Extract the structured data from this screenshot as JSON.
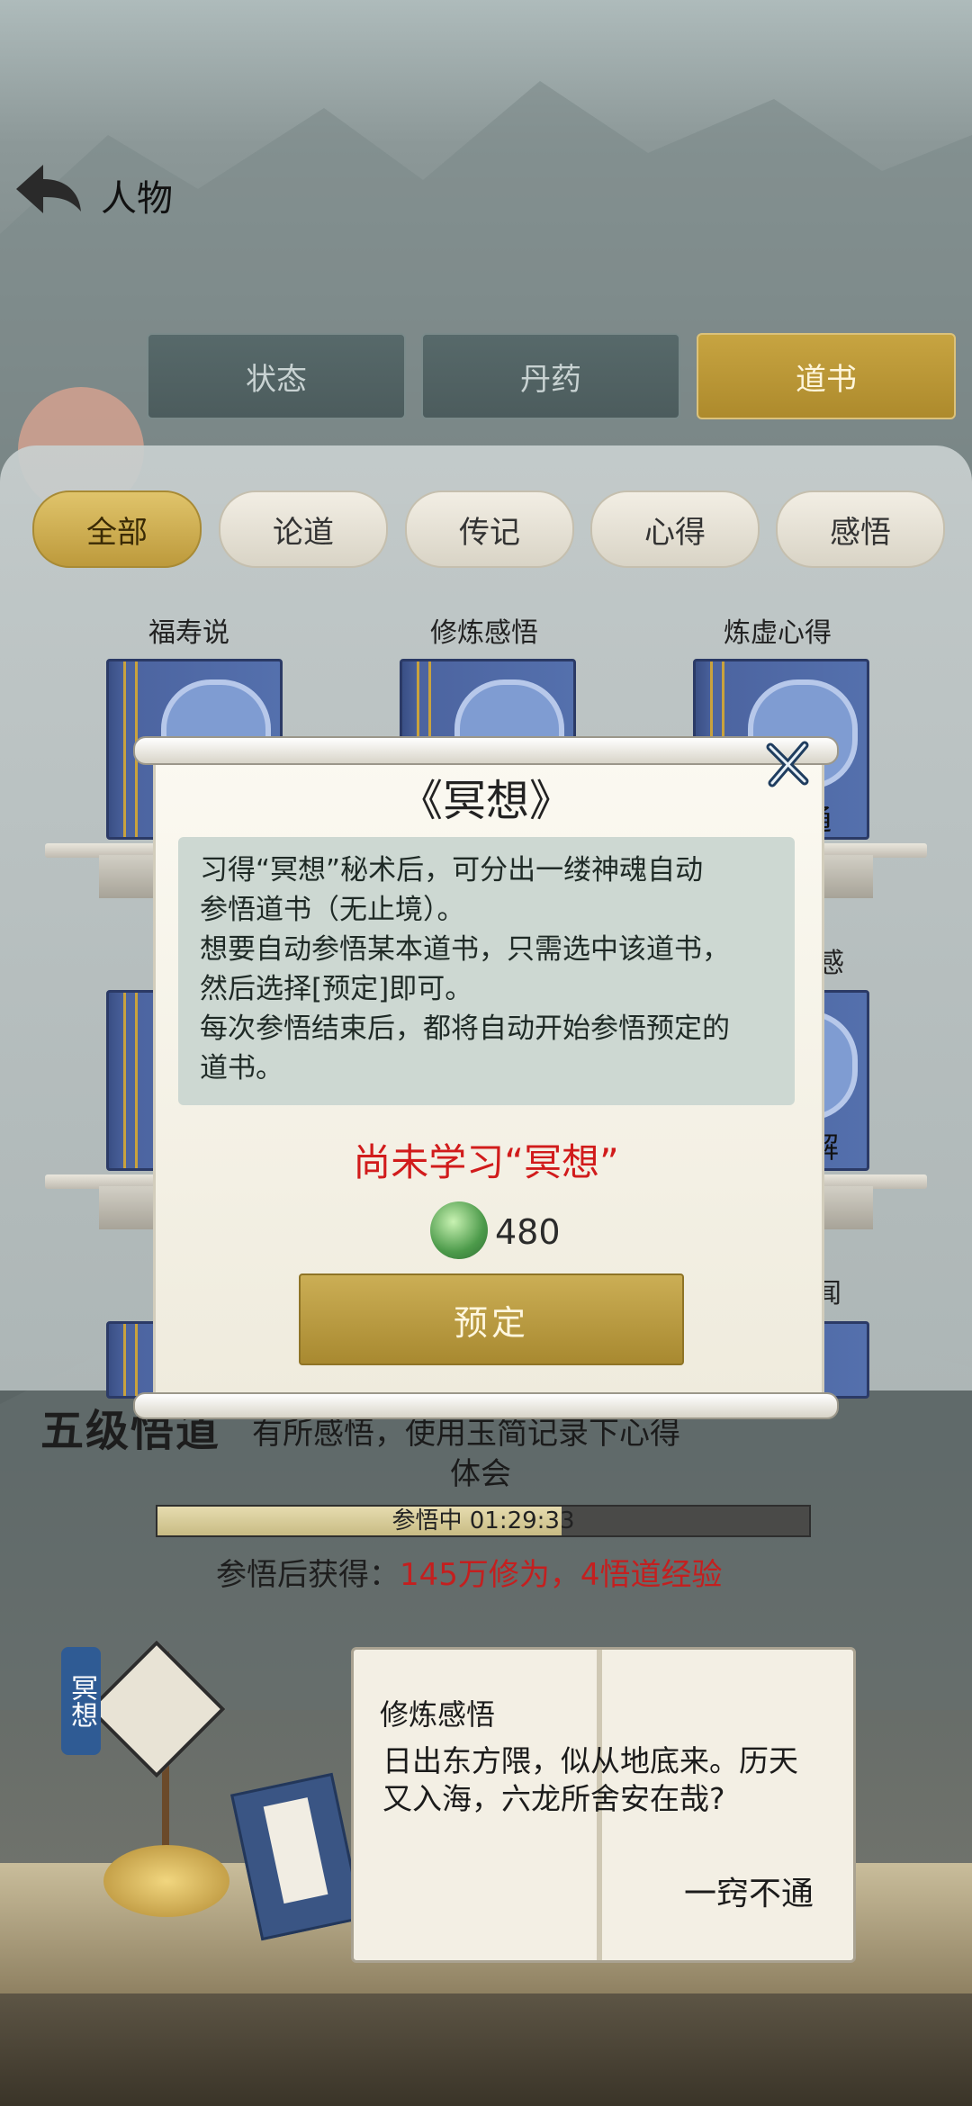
{
  "header": {
    "title": "人物"
  },
  "main_tabs": [
    {
      "label": "状态"
    },
    {
      "label": "丹药"
    },
    {
      "label": "道书",
      "active": true
    }
  ],
  "sub_tabs": [
    {
      "label": "全部",
      "active": true
    },
    {
      "label": "论道"
    },
    {
      "label": "传记"
    },
    {
      "label": "心得"
    },
    {
      "label": "感悟"
    }
  ],
  "books": [
    {
      "title": "福寿说"
    },
    {
      "title": "修炼感悟"
    },
    {
      "title": "炼虚心得"
    }
  ],
  "partial_labels": {
    "right_top_status": "通",
    "right_mid_title": "感",
    "right_mid_status": "解",
    "right_bottom_title": "闻"
  },
  "progress": {
    "rank": "五级悟道",
    "hint_line1": "有所感悟，使用玉简记录下心得",
    "hint_line2": "体会",
    "status": "参悟中 01:29:33",
    "fraction": 0.62,
    "reward_label": "参悟后获得：",
    "reward_value": "145万修为，4悟道经验"
  },
  "scene": {
    "meditate_tag": "冥想",
    "open_book": {
      "heading": "修炼感悟",
      "line1": "日出东方隈，似从地底来。历天",
      "line2": "又入海，六龙所舍安在哉?",
      "status": "一窍不通"
    }
  },
  "modal": {
    "title": "《冥想》",
    "desc_lines": [
      "习得“冥想”秘术后，可分出一缕神魂自动",
      "参悟道书（无止境）。",
      "想要自动参悟某本道书，只需选中该道书，",
      "然后选择[预定]即可。",
      "每次参悟结束后，都将自动开始参悟预定的",
      "道书。"
    ],
    "warning": "尚未学习“冥想”",
    "cost_value": "480",
    "button_label": "预定"
  },
  "colors": {
    "accent_gold": "#bd9a3c",
    "warning_red": "#d11b1b",
    "reward_red": "#c41f1f"
  }
}
